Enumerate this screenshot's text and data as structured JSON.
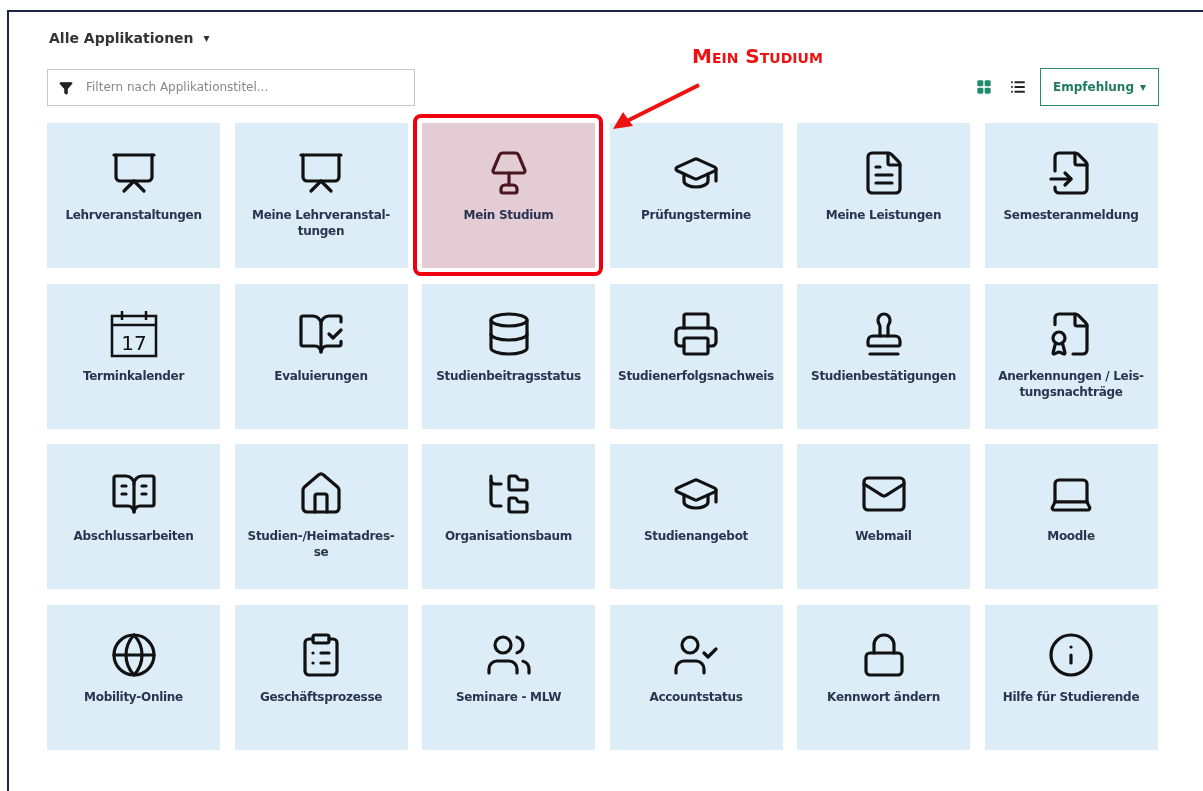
{
  "header": {
    "title": "Alle Applikationen",
    "caret": "▾"
  },
  "filter": {
    "placeholder": "Filtern nach Applikationstitel..."
  },
  "view_options": [
    {
      "selected": true
    },
    {
      "selected": false
    }
  ],
  "sort_button": {
    "label": "Empfehlung",
    "caret": "▾"
  },
  "annotation": {
    "text": "Mein Studium"
  },
  "tiles": [
    {
      "label": "Lehrveranstaltungen",
      "selected": false
    },
    {
      "label": "Meine Lehrveranstal-\ntungen",
      "selected": false
    },
    {
      "label": "Mein Studium",
      "selected": true
    },
    {
      "label": "Prüfungstermine",
      "selected": false
    },
    {
      "label": "Meine Leistungen",
      "selected": false
    },
    {
      "label": "Semesteranmeldung",
      "selected": false
    },
    {
      "label": "Terminkalender",
      "selected": false,
      "icon_text": "17"
    },
    {
      "label": "Evaluierungen",
      "selected": false
    },
    {
      "label": "Studienbeitragsstatus",
      "selected": false
    },
    {
      "label": "Studienerfolgsnachweis",
      "selected": false
    },
    {
      "label": "Studienbestätigungen",
      "selected": false
    },
    {
      "label": "Anerkennungen / Leis-\ntungsnachträge",
      "selected": false
    },
    {
      "label": "Abschlussarbeiten",
      "selected": false
    },
    {
      "label": "Studien-/Heimatadres-\nse",
      "selected": false
    },
    {
      "label": "Organisationsbaum",
      "selected": false
    },
    {
      "label": "Studienangebot",
      "selected": false
    },
    {
      "label": "Webmail",
      "selected": false
    },
    {
      "label": "Moodle",
      "selected": false
    },
    {
      "label": "Mobility-Online",
      "selected": false
    },
    {
      "label": "Geschäftsprozesse",
      "selected": false
    },
    {
      "label": "Seminare - MLW",
      "selected": false
    },
    {
      "label": "Accountstatus",
      "selected": false
    },
    {
      "label": "Kennwort ändern",
      "selected": false
    },
    {
      "label": "Hilfe für Studierende",
      "selected": false
    }
  ]
}
